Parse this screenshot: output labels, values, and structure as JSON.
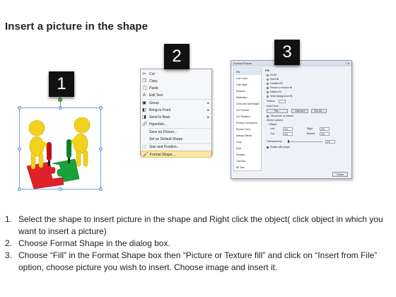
{
  "page": {
    "title": "Insert a picture in the shape"
  },
  "badges": [
    "1",
    "2",
    "3"
  ],
  "context_menu": {
    "items": [
      {
        "label": "Cut",
        "icon": "scissors-icon",
        "glyph": "✂"
      },
      {
        "label": "Copy",
        "icon": "copy-icon",
        "glyph": "❐"
      },
      {
        "label": "Paste",
        "icon": "paste-icon",
        "glyph": "📋"
      },
      {
        "label": "Edit Text",
        "icon": "edit-text-icon",
        "glyph": "A"
      },
      {
        "label": "Group",
        "icon": "group-icon",
        "glyph": "▣",
        "submenu": true
      },
      {
        "label": "Bring to Front",
        "icon": "bring-front-icon",
        "glyph": "◧",
        "submenu": true
      },
      {
        "label": "Send to Back",
        "icon": "send-back-icon",
        "glyph": "◨",
        "submenu": true
      },
      {
        "label": "Hyperlink...",
        "icon": "hyperlink-icon",
        "glyph": "🔗"
      },
      {
        "label": "Save as Picture...",
        "icon": "",
        "glyph": ""
      },
      {
        "label": "Set as Default Shape",
        "icon": "",
        "glyph": ""
      },
      {
        "label": "Size and Position...",
        "icon": "size-icon",
        "glyph": "⬚"
      },
      {
        "label": "Format Shape...",
        "icon": "format-shape-icon",
        "glyph": "🖌"
      }
    ]
  },
  "dialog": {
    "title": "Format Picture",
    "close_label": "Close",
    "nav": [
      "Fill",
      "Line Color",
      "Line Style",
      "Shadow",
      "Reflection",
      "Glow and Soft Edges",
      "3-D Format",
      "3-D Rotation",
      "Picture Corrections",
      "Picture Color",
      "Artistic Effects",
      "Crop",
      "Size",
      "Position",
      "Text Box",
      "Alt Text"
    ],
    "fill_heading": "Fill",
    "fill_options": [
      "No fill",
      "Solid fill",
      "Gradient fill",
      "Picture or texture fill",
      "Pattern fill",
      "Slide background fill"
    ],
    "texture_label": "Texture:",
    "insert_from_label": "Insert from:",
    "insert_buttons": [
      "File...",
      "Clipboard",
      "Clip Art..."
    ],
    "tile_label": "Tile picture as texture",
    "stretch_label": "Stretch options",
    "offsets_label": "Offsets:",
    "offsets": [
      {
        "label": "Left:",
        "value": "0%"
      },
      {
        "label": "Right:",
        "value": "0%"
      },
      {
        "label": "Top:",
        "value": "0%"
      },
      {
        "label": "Bottom:",
        "value": "0%"
      }
    ],
    "transparency_label": "Transparency:",
    "transparency_value": "0%",
    "rotate_label": "Rotate with shape"
  },
  "instructions": [
    {
      "num": "1.",
      "text": "Select the shape to insert picture in the shape and Right click the object( click object in which you want to insert a picture)"
    },
    {
      "num": "2.",
      "text": "Choose Format Shape in the dialog box."
    },
    {
      "num": "3.",
      "text": "Choose “Fill” in the Format Shape box then “Picture or Texture fill”  and click on “Insert from File” option, choose picture you wish to insert. Choose image and insert it."
    }
  ],
  "colors": {
    "figure": "#f2d21c",
    "puzzle_red": "#e0202a",
    "puzzle_green": "#18a33a",
    "selection": "#7aa7d6",
    "menu_highlight": "#f7e7a8"
  }
}
